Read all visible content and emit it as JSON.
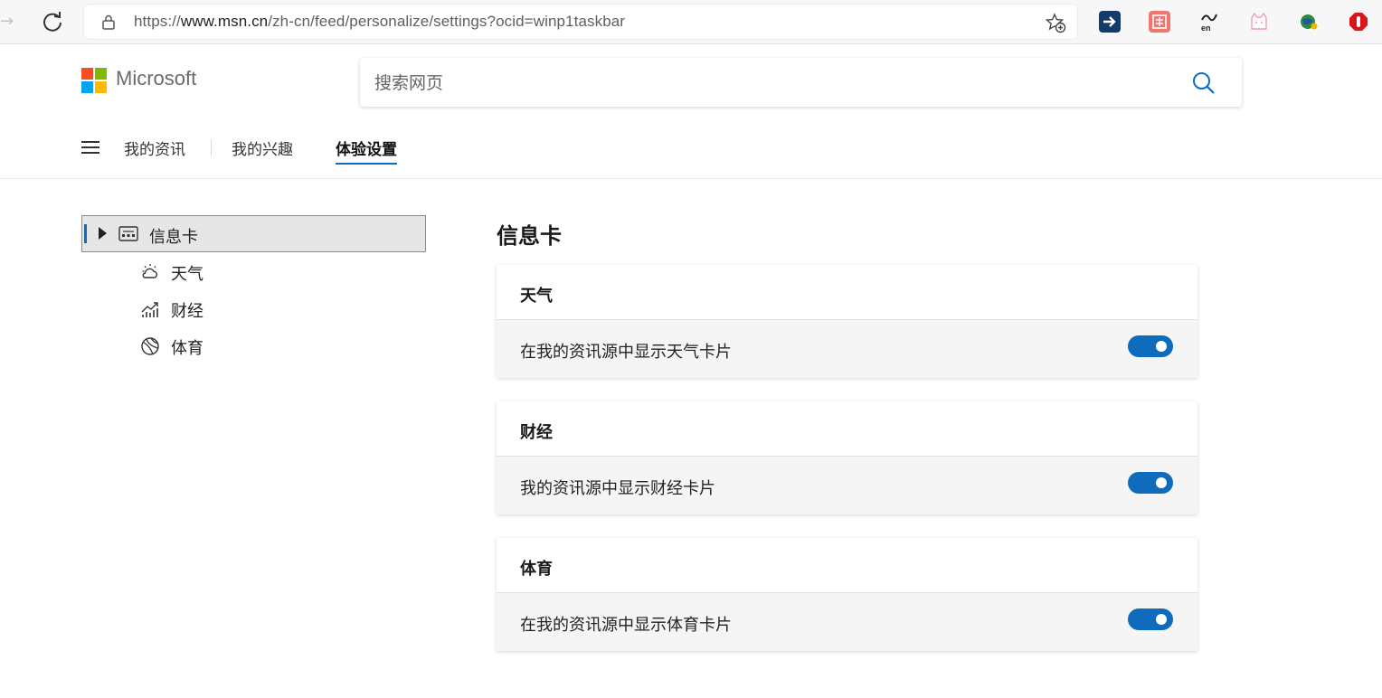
{
  "browser": {
    "url_prefix": "https://",
    "url_host": "www.msn.cn",
    "url_path": "/zh-cn/feed/personalize/settings?ocid=winp1taskbar",
    "extensions": [
      "arrow-extension-icon",
      "translate-extension-icon",
      "en-dictionary-extension-icon",
      "cat-extension-icon",
      "globe-extension-icon",
      "stop-extension-icon"
    ]
  },
  "header": {
    "brand": "Microsoft",
    "search_placeholder": "搜索网页"
  },
  "tabs": [
    {
      "label": "我的资讯",
      "active": false
    },
    {
      "label": "我的兴趣",
      "active": false
    },
    {
      "label": "体验设置",
      "active": true
    }
  ],
  "sidebar": {
    "head_label": "信息卡",
    "items": [
      {
        "label": "天气",
        "icon": "weather-icon"
      },
      {
        "label": "财经",
        "icon": "finance-icon"
      },
      {
        "label": "体育",
        "icon": "sports-icon"
      }
    ]
  },
  "main": {
    "title": "信息卡",
    "cards": [
      {
        "title": "天气",
        "setting": "在我的资讯源中显示天气卡片",
        "enabled": true
      },
      {
        "title": "财经",
        "setting": "我的资讯源中显示财经卡片",
        "enabled": true
      },
      {
        "title": "体育",
        "setting": "在我的资讯源中显示体育卡片",
        "enabled": true
      }
    ]
  },
  "colors": {
    "accent": "#0f6cbd",
    "ms_red": "#f25022",
    "ms_green": "#7fba00",
    "ms_blue": "#00a4ef",
    "ms_yellow": "#ffb900"
  }
}
